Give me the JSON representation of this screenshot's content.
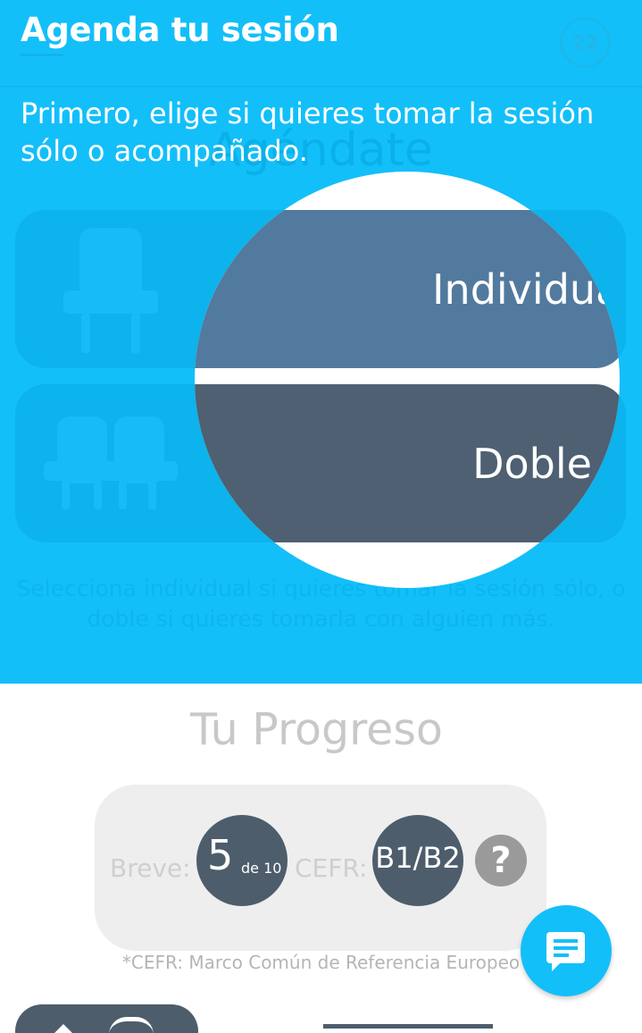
{
  "header": {
    "title": "Agenda tu sesión",
    "credits": "22"
  },
  "background": {
    "heading": "Agéndate",
    "caption": "Selecciona individual si quieres tomar la sesión sólo, o doble si quieres tomarla con alguien más."
  },
  "tutorial": {
    "instruction": "Primero, elige si quieres tomar la sesión sólo o acompañado."
  },
  "options": [
    {
      "label": "Individual",
      "icon": "chair-icon"
    },
    {
      "label": "Doble",
      "icon": "double-chair-icon"
    }
  ],
  "progress": {
    "title": "Tu Progreso",
    "breve_label": "Breve:",
    "breve_value": "5",
    "breve_of": "de 10",
    "cefr_label": "CEFR:",
    "cefr_value": "B1/B2",
    "help_icon": "?",
    "footnote": "*CEFR: Marco Común de Referencia Europeo"
  },
  "colors": {
    "primary": "#13bff9",
    "individual": "#527a9e",
    "doble": "#4e6072",
    "dark": "#4e5d6c"
  }
}
